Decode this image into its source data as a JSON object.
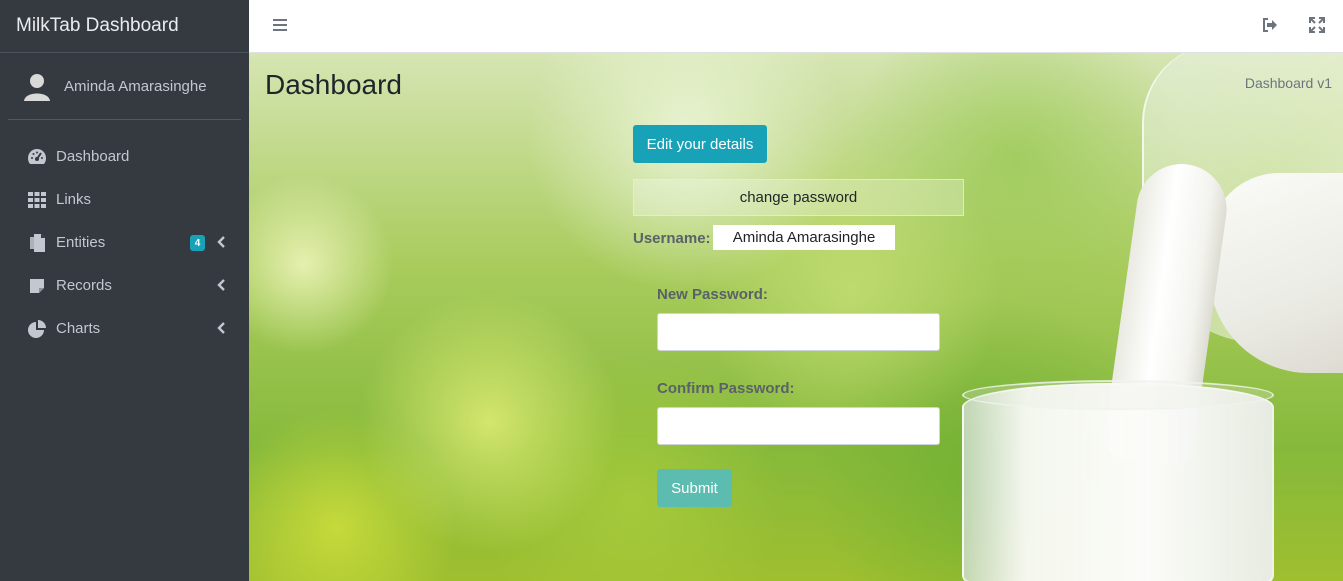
{
  "brand": {
    "title": "MilkTab Dashboard"
  },
  "user": {
    "name": "Aminda Amarasinghe"
  },
  "sidebar": {
    "items": [
      {
        "label": "Dashboard",
        "icon": "tachometer-icon"
      },
      {
        "label": "Links",
        "icon": "grid-icon"
      },
      {
        "label": "Entities",
        "icon": "copy-icon",
        "badge": "4",
        "has_submenu": true
      },
      {
        "label": "Records",
        "icon": "sticky-note-icon",
        "has_submenu": true
      },
      {
        "label": "Charts",
        "icon": "pie-chart-icon",
        "has_submenu": true
      }
    ]
  },
  "topbar": {
    "icons": [
      "hamburger-icon",
      "sign-out-icon",
      "expand-icon"
    ]
  },
  "page": {
    "title": "Dashboard",
    "breadcrumb": "Dashboard v1"
  },
  "form": {
    "edit_button": "Edit your details",
    "section_title": "change password",
    "username_label": "Username:",
    "username_value": "Aminda Amarasinghe",
    "new_password_label": "New Password:",
    "new_password_value": "",
    "confirm_password_label": "Confirm Password:",
    "confirm_password_value": "",
    "submit_button": "Submit"
  },
  "colors": {
    "sidebar_bg": "#343a40",
    "accent": "#17a2b8",
    "submit": "#5cbcaf",
    "badge": "#17a2b8"
  }
}
